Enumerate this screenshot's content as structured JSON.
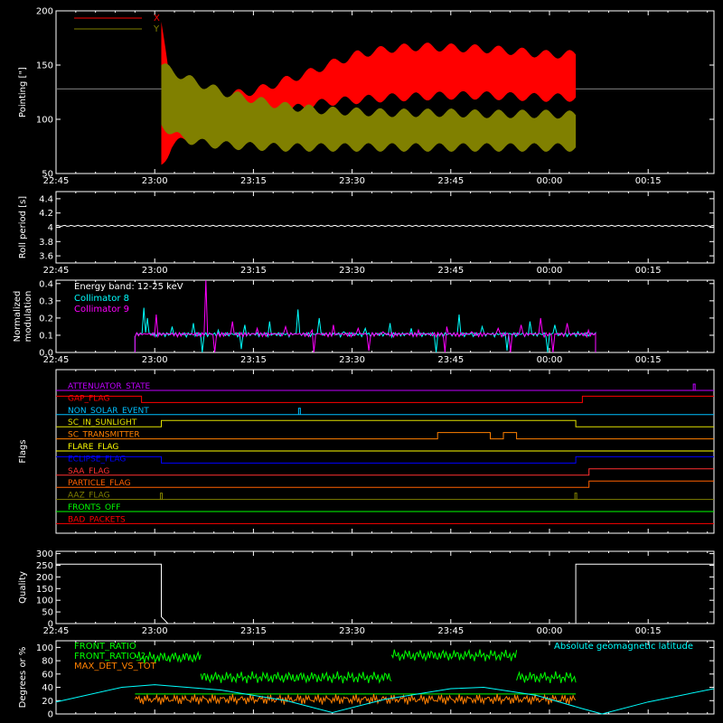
{
  "chart_data": [
    {
      "id": "pointing",
      "type": "line",
      "ylabel": "Pointing [\"]",
      "ylim": [
        50,
        200
      ],
      "yticks": [
        50,
        100,
        150,
        200
      ],
      "time_ticks": [
        "22:45",
        "23:00",
        "23:15",
        "23:30",
        "23:45",
        "00:00",
        "00:15"
      ],
      "legend": [
        {
          "name": "X",
          "color": "#ff0000"
        },
        {
          "name": "Y",
          "color": "#808000"
        }
      ],
      "reference_value": 128,
      "reference_color": "#808080",
      "active_window": {
        "start": "23:01",
        "end": "00:04"
      },
      "series": [
        {
          "name": "X",
          "color": "#ff0000",
          "upper": [
            [
              0,
              190
            ],
            [
              5,
              120
            ],
            [
              10,
              118
            ],
            [
              20,
              120
            ],
            [
              30,
              122
            ],
            [
              45,
              126
            ],
            [
              60,
              136
            ],
            [
              70,
              142
            ],
            [
              80,
              150
            ],
            [
              95,
              160
            ],
            [
              110,
              165
            ],
            [
              125,
              167
            ],
            [
              140,
              166
            ],
            [
              155,
              165
            ],
            [
              170,
              163
            ],
            [
              185,
              160
            ],
            [
              200,
              160
            ]
          ],
          "lower": [
            [
              0,
              58
            ],
            [
              5,
              75
            ],
            [
              10,
              80
            ],
            [
              20,
              88
            ],
            [
              30,
              95
            ],
            [
              45,
              102
            ],
            [
              60,
              108
            ],
            [
              70,
              112
            ],
            [
              80,
              116
            ],
            [
              95,
              118
            ],
            [
              110,
              120
            ],
            [
              125,
              121
            ],
            [
              140,
              122
            ],
            [
              155,
              122
            ],
            [
              170,
              121
            ],
            [
              185,
              120
            ],
            [
              200,
              120
            ]
          ]
        },
        {
          "name": "Y",
          "color": "#808000",
          "upper": [
            [
              0,
              150
            ],
            [
              5,
              145
            ],
            [
              10,
              140
            ],
            [
              20,
              132
            ],
            [
              30,
              125
            ],
            [
              45,
              118
            ],
            [
              60,
              112
            ],
            [
              70,
              110
            ],
            [
              80,
              108
            ],
            [
              95,
              107
            ],
            [
              110,
              106
            ],
            [
              125,
              106
            ],
            [
              140,
              106
            ],
            [
              155,
              105
            ],
            [
              170,
              105
            ],
            [
              185,
              105
            ],
            [
              200,
              104
            ]
          ],
          "lower": [
            [
              0,
              95
            ],
            [
              5,
              88
            ],
            [
              10,
              82
            ],
            [
              20,
              78
            ],
            [
              30,
              76
            ],
            [
              45,
              75
            ],
            [
              60,
              74
            ],
            [
              70,
              74
            ],
            [
              80,
              74
            ],
            [
              95,
              74
            ],
            [
              110,
              74
            ],
            [
              125,
              74
            ],
            [
              140,
              74
            ],
            [
              155,
              74
            ],
            [
              170,
              74
            ],
            [
              185,
              74
            ],
            [
              200,
              74
            ]
          ]
        }
      ]
    },
    {
      "id": "roll_period",
      "type": "line",
      "ylabel": "Roll period [s]",
      "ylim": [
        3.5,
        4.5
      ],
      "yticks": [
        3.6,
        3.8,
        4.0,
        4.2,
        4.4
      ],
      "time_ticks": [
        "22:45",
        "23:00",
        "23:15",
        "23:30",
        "23:45",
        "00:00",
        "00:15"
      ],
      "series": [
        {
          "name": "Roll period",
          "color": "#ffffff",
          "value": 4.02
        }
      ]
    },
    {
      "id": "modulation",
      "type": "line",
      "ylabel": "Normalized modulation",
      "ylabel_lines": [
        "Normalized",
        "modulation"
      ],
      "ylim": [
        0,
        0.42
      ],
      "yticks": [
        0.0,
        0.1,
        0.2,
        0.3,
        0.4
      ],
      "time_ticks": [
        "22:45",
        "23:00",
        "23:15",
        "23:30",
        "23:45",
        "00:00",
        "00:15"
      ],
      "annotation": "Energy band: 12-25 keV",
      "active_window": {
        "start": "22:57",
        "end": "00:07"
      },
      "baseline": 0.09,
      "series": [
        {
          "name": "Collimator 8",
          "color": "#00ffff",
          "spikes": [
            [
              5,
              0.26
            ],
            [
              7,
              0.2
            ],
            [
              21,
              0.15
            ],
            [
              33,
              0.17
            ],
            [
              47,
              0.13
            ],
            [
              62,
              0.16
            ],
            [
              76,
              0.18
            ],
            [
              92,
              0.25
            ],
            [
              104,
              0.2
            ],
            [
              118,
              0.12
            ],
            [
              130,
              0.14
            ],
            [
              144,
              0.17
            ],
            [
              156,
              0.14
            ],
            [
              170,
              0.18
            ],
            [
              183,
              0.22
            ],
            [
              196,
              0.15
            ],
            [
              210,
              0.13
            ],
            [
              223,
              0.18
            ],
            [
              237,
              0.16
            ],
            [
              250,
              0.12
            ]
          ],
          "dips": [
            [
              38,
              0.0
            ],
            [
              60,
              0.02
            ],
            [
              170,
              0.0
            ],
            [
              210,
              0.01
            ],
            [
              233,
              0.0
            ]
          ]
        },
        {
          "name": "Collimator 9",
          "color": "#ff00ff",
          "spikes": [
            [
              12,
              0.22
            ],
            [
              40,
              0.42
            ],
            [
              55,
              0.18
            ],
            [
              69,
              0.14
            ],
            [
              85,
              0.15
            ],
            [
              100,
              0.13
            ],
            [
              112,
              0.16
            ],
            [
              126,
              0.14
            ],
            [
              140,
              0.12
            ],
            [
              160,
              0.13
            ],
            [
              176,
              0.15
            ],
            [
              190,
              0.12
            ],
            [
              205,
              0.14
            ],
            [
              218,
              0.16
            ],
            [
              229,
              0.2
            ],
            [
              244,
              0.17
            ],
            [
              256,
              0.13
            ]
          ],
          "dips": [
            [
              45,
              0.0
            ],
            [
              101,
              0.0
            ],
            [
              132,
              0.01
            ],
            [
              175,
              0.0
            ],
            [
              212,
              0.0
            ],
            [
              236,
              0.0
            ]
          ]
        }
      ]
    },
    {
      "id": "flags",
      "type": "line",
      "ylabel": "Flags",
      "rows": [
        {
          "name": "ATTENUATOR_STATE",
          "color": "#c000ff",
          "segments": [
            [
              "22:45",
              "00:25",
              "low"
            ]
          ],
          "high_spikes": [
            "00:22"
          ]
        },
        {
          "name": "SAA_FLAG",
          "color": "#ff0000",
          "label_override": "GAP_FLAG",
          "segments": [
            [
              "22:45",
              "22:58",
              "high"
            ],
            [
              "22:58",
              "00:05",
              "low"
            ],
            [
              "00:05",
              "00:25",
              "high"
            ]
          ]
        },
        {
          "name": "NON_SOLAR_EVENT",
          "color": "#00c0ff",
          "segments": [
            [
              "22:45",
              "00:25",
              "low"
            ]
          ],
          "high_spikes": [
            "23:22"
          ]
        },
        {
          "name": "SC_IN_SUNLIGHT",
          "color": "#e0e000",
          "segments": [
            [
              "22:45",
              "23:01",
              "low"
            ],
            [
              "23:01",
              "00:04",
              "high"
            ],
            [
              "00:04",
              "00:25",
              "low"
            ]
          ]
        },
        {
          "name": "SC_TRANSMITTER",
          "color": "#ff8000",
          "segments": [
            [
              "22:45",
              "23:43",
              "low"
            ],
            [
              "23:43",
              "23:51",
              "high"
            ],
            [
              "23:51",
              "23:53",
              "low"
            ],
            [
              "23:53",
              "23:55",
              "high"
            ],
            [
              "23:55",
              "00:25",
              "low"
            ]
          ]
        },
        {
          "name": "FLARE_FLAG",
          "color": "#ffff00",
          "segments": [
            [
              "22:45",
              "00:25",
              "low"
            ]
          ]
        },
        {
          "name": "ECLIPSE_FLAG",
          "color": "#0000ff",
          "segments": [
            [
              "22:45",
              "23:01",
              "high"
            ],
            [
              "23:01",
              "00:04",
              "low"
            ],
            [
              "00:04",
              "00:25",
              "high"
            ]
          ]
        },
        {
          "name": "SAA_FLAG",
          "color": "#ff3030",
          "segments": [
            [
              "22:45",
              "00:06",
              "low"
            ],
            [
              "00:06",
              "00:25",
              "high"
            ]
          ]
        },
        {
          "name": "PARTICLE_FLAG",
          "color": "#ff6000",
          "segments": [
            [
              "22:45",
              "00:06",
              "low"
            ],
            [
              "00:06",
              "00:25",
              "high"
            ]
          ]
        },
        {
          "name": "AAZ_FLAG",
          "color": "#808000",
          "segments": [
            [
              "22:45",
              "00:25",
              "low"
            ]
          ],
          "high_spikes": [
            "23:01",
            "00:04"
          ]
        },
        {
          "name": "FRONTS_OFF",
          "color": "#00ff00",
          "segments": [
            [
              "22:45",
              "00:25",
              "low"
            ]
          ]
        },
        {
          "name": "BAD_PACKETS",
          "color": "#ff0000",
          "segments": [
            [
              "22:45",
              "00:25",
              "low"
            ]
          ]
        }
      ]
    },
    {
      "id": "quality",
      "type": "line",
      "ylabel": "Quality",
      "ylim": [
        0,
        310
      ],
      "yticks": [
        0,
        50,
        100,
        150,
        200,
        250,
        300
      ],
      "time_ticks": [
        "22:45",
        "23:00",
        "23:15",
        "23:30",
        "23:45",
        "00:00",
        "00:15"
      ],
      "series": [
        {
          "name": "Quality",
          "color": "#ffffff",
          "points": [
            [
              "22:45",
              255
            ],
            [
              "23:01",
              255
            ],
            [
              "23:01",
              30
            ],
            [
              "23:02",
              0
            ],
            [
              "00:04",
              0
            ],
            [
              "00:04",
              255
            ],
            [
              "00:25",
              255
            ]
          ]
        }
      ]
    },
    {
      "id": "geomag",
      "type": "line",
      "ylabel": "Degrees or %",
      "ylim": [
        0,
        110
      ],
      "yticks": [
        0,
        20,
        40,
        60,
        80,
        100
      ],
      "legend": [
        {
          "name": "FRONT_RATIO",
          "color": "#00ff00"
        },
        {
          "name": "FRONT_RATIO_?",
          "color": "#00ff00"
        },
        {
          "name": "MAX_DET_VS_TOT",
          "color": "#ff8000"
        }
      ],
      "annotation": "Absolute geomagnetic latitude",
      "annotation_color": "#00ffff",
      "series": [
        {
          "name": "FRONT_RATIO",
          "color": "#00ff00",
          "levels": [
            [
              "22:57",
              30,
              "00:04",
              0
            ],
            [
              "22:57",
              85,
              "23:07",
              0
            ],
            [
              "23:07",
              55,
              "23:36",
              0
            ],
            [
              "23:36",
              88,
              "23:55",
              0
            ],
            [
              "23:55",
              55,
              "00:04",
              0
            ]
          ]
        },
        {
          "name": "MAX_DET_VS_TOT",
          "color": "#ff8000",
          "level": 22,
          "range": [
            "22:57",
            "00:04"
          ]
        },
        {
          "name": "Absolute geomagnetic latitude",
          "color": "#00ffff",
          "points": [
            [
              "22:45",
              18
            ],
            [
              "22:55",
              40
            ],
            [
              "23:00",
              44
            ],
            [
              "23:10",
              36
            ],
            [
              "23:20",
              20
            ],
            [
              "23:27",
              2
            ],
            [
              "23:35",
              22
            ],
            [
              "23:45",
              38
            ],
            [
              "23:50",
              40
            ],
            [
              "23:58",
              28
            ],
            [
              "00:05",
              8
            ],
            [
              "00:08",
              0
            ],
            [
              "00:15",
              18
            ],
            [
              "00:25",
              38
            ]
          ]
        }
      ]
    }
  ]
}
